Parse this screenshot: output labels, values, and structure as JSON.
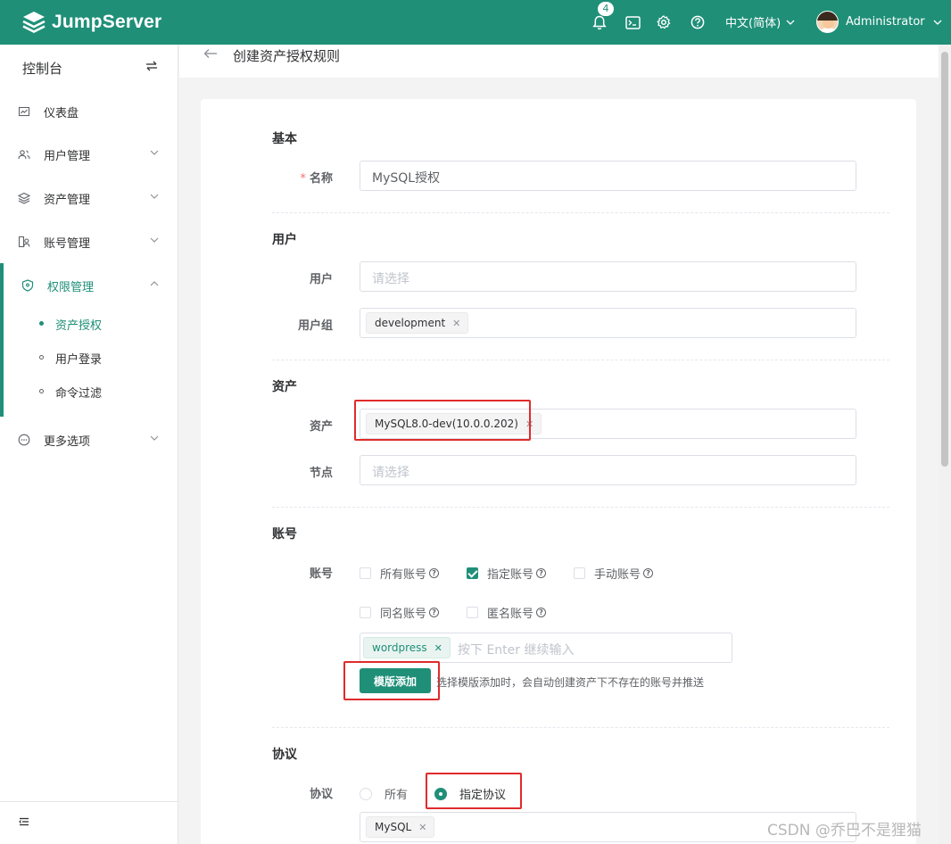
{
  "topbar": {
    "brand": "JumpServer",
    "notification_count": "4",
    "language": "中文(简体)",
    "username": "Administrator",
    "icons": [
      "bell-icon",
      "terminal-icon",
      "gear-icon",
      "help-icon"
    ],
    "accent_color": "#1f8f78"
  },
  "sidebar": {
    "title": "控制台",
    "items": [
      {
        "label": "仪表盘",
        "icon": "dashboard-icon"
      },
      {
        "label": "用户管理",
        "icon": "users-icon"
      },
      {
        "label": "资产管理",
        "icon": "layers-icon"
      },
      {
        "label": "账号管理",
        "icon": "account-icon"
      },
      {
        "label": "权限管理",
        "icon": "shield-icon"
      },
      {
        "label": "更多选项",
        "icon": "more-icon"
      }
    ],
    "sub_items": [
      {
        "label": "资产授权",
        "active": true
      },
      {
        "label": "用户登录",
        "active": false
      },
      {
        "label": "命令过滤",
        "active": false
      }
    ]
  },
  "page": {
    "title": "创建资产授权规则"
  },
  "form": {
    "basic": {
      "section": "基本",
      "name_label": "名称",
      "name_value": "MySQL授权"
    },
    "user": {
      "section": "用户",
      "user_label": "用户",
      "user_placeholder": "请选择",
      "group_label": "用户组",
      "group_tag": "development"
    },
    "asset": {
      "section": "资产",
      "asset_label": "资产",
      "asset_tag": "MySQL8.0-dev(10.0.0.202)",
      "node_label": "节点",
      "node_placeholder": "请选择"
    },
    "account": {
      "section": "账号",
      "label": "账号",
      "options": [
        {
          "label": "所有账号",
          "checked": false
        },
        {
          "label": "指定账号",
          "checked": true
        },
        {
          "label": "手动账号",
          "checked": false
        },
        {
          "label": "同名账号",
          "checked": false
        },
        {
          "label": "匿名账号",
          "checked": false
        }
      ],
      "tag": "wordpress",
      "input_placeholder": "按下 Enter 继续输入",
      "template_button": "模版添加",
      "template_hint": "选择模版添加时，会自动创建资产下不存在的账号并推送"
    },
    "protocol": {
      "section": "协议",
      "label": "协议",
      "options": [
        {
          "label": "所有",
          "checked": false
        },
        {
          "label": "指定协议",
          "checked": true
        }
      ],
      "tag": "MySQL"
    }
  },
  "watermark": "CSDN @乔巴不是狸猫"
}
